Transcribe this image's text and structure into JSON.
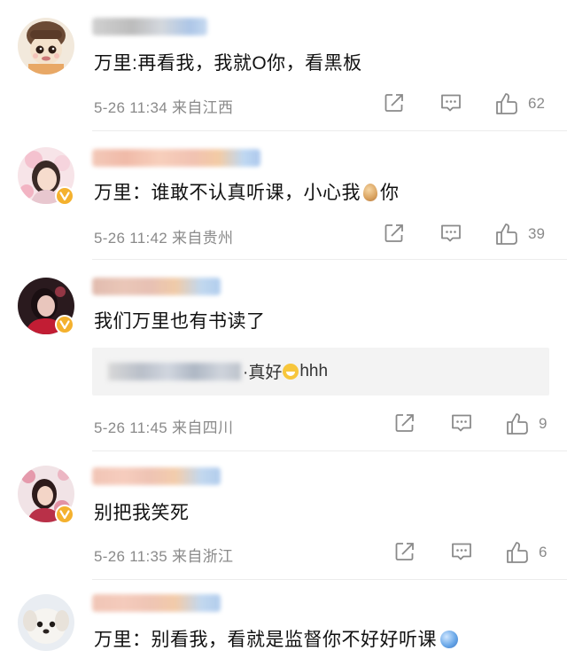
{
  "comments": [
    {
      "text": "万里:再看我，我就O你，看黑板",
      "meta": "5-26 11:34 来自江西",
      "likes": "62",
      "verified": false
    },
    {
      "text_before": "万里：谁敢不认真听课，小心我",
      "emoji": "egg",
      "text_after": "你",
      "meta": "5-26 11:42 来自贵州",
      "likes": "39",
      "verified": true
    },
    {
      "text": "我们万里也有书读了",
      "reply": {
        "visible_before": "·真好",
        "emoji": "laugh",
        "visible_after": "hhh"
      },
      "meta": "5-26 11:45 来自四川",
      "likes": "9",
      "verified": true
    },
    {
      "text": "别把我笑死",
      "meta": "5-26 11:35 来自浙江",
      "likes": "6",
      "verified": true
    },
    {
      "text": "万里：别看我，看就是监督你不好好听课",
      "emoji": "globe",
      "verified": false
    }
  ],
  "icons": {
    "share": "share-icon",
    "comment": "comment-icon",
    "like": "like-icon",
    "verified": "verified-badge-icon"
  },
  "colors": {
    "verified_badge": "#f4b12e",
    "meta_text": "#8a8a8a",
    "divider": "#ececec"
  }
}
